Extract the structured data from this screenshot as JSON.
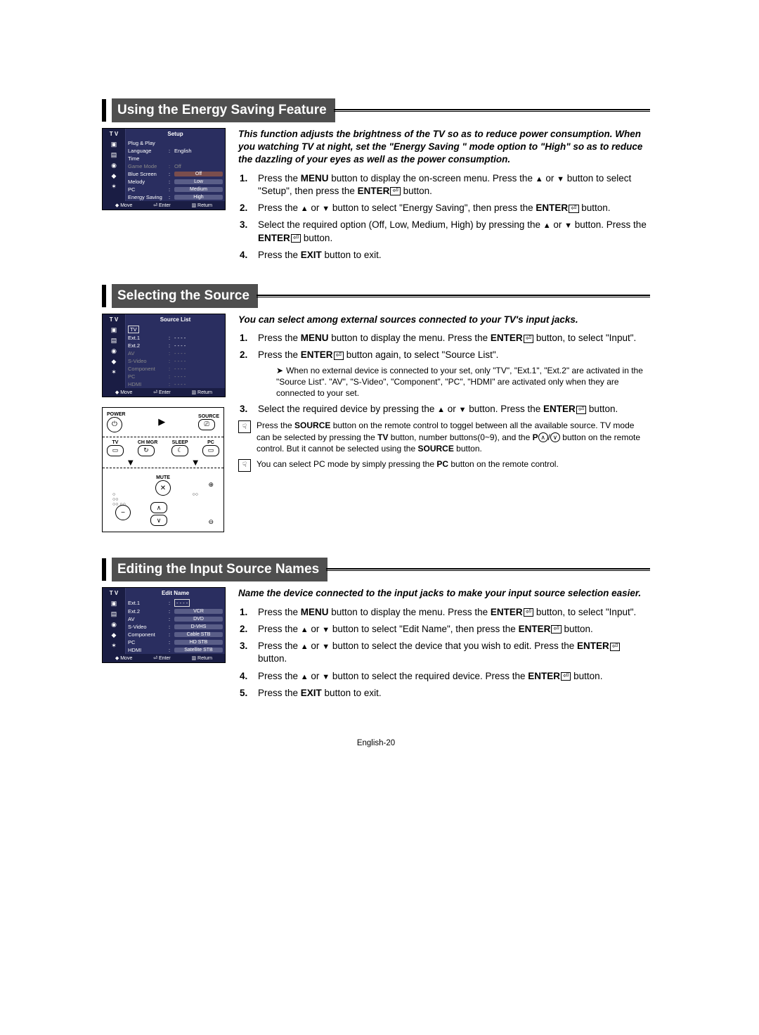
{
  "section1": {
    "title": "Using the Energy Saving Feature",
    "intro": "This function adjusts the brightness of the TV so as to reduce power consumption. When you watching TV at night, set the  \"Energy Saving \" mode option to \"High\" so as to reduce the dazzling of your eyes as well as the power consumption.",
    "steps": {
      "s1a": "Press the ",
      "s1b": " button to display the on-screen menu. Press the ",
      "s1c": " button to select \"Setup\", then press the ",
      "s1d": " button.",
      "s2a": "Press the ",
      "s2b": " button to select \"Energy Saving\", then press the ",
      "s2c": " button.",
      "s3a": "Select the required option (Off, Low, Medium, High) by pressing the ",
      "s3b": " button. Press the ",
      "s3c": " button.",
      "s4a": "Press the ",
      "s4b": " button to exit."
    },
    "osd": {
      "left": "T V",
      "title": "Setup",
      "rows": [
        {
          "label": "Plug & Play",
          "value": ""
        },
        {
          "label": "Language",
          "value": "English"
        },
        {
          "label": "Time",
          "value": ""
        },
        {
          "label": "Game Mode",
          "value": "Off",
          "dim": true
        },
        {
          "label": "Blue Screen",
          "value": "Off",
          "box": true,
          "hl": true
        },
        {
          "label": "Melody",
          "value": "Low",
          "box": true
        },
        {
          "label": "PC",
          "value": "Medium",
          "box": true
        },
        {
          "label": "Energy Saving",
          "value": "High",
          "box": true
        }
      ],
      "footer": {
        "move": "Move",
        "enter": "Enter",
        "ret": "Return"
      }
    }
  },
  "section2": {
    "title": "Selecting the Source",
    "intro": "You can select among external sources connected to your TV's input jacks.",
    "steps": {
      "s1a": "Press the ",
      "s1b": " button to display the menu. Press the ",
      "s1c": " button, to select \"Input\".",
      "s2a": "Press the ",
      "s2b": " button again, to select \"Source List\".",
      "note2": "When no external device is connected to your set, only \"TV\", \"Ext.1\", \"Ext.2\" are activated in the \"Source List\". \"AV\", \"S-Video\", \"Component\", \"PC\", \"HDMI\" are activated only when they are connected to your set.",
      "s3a": "Select the required device by pressing the ",
      "s3b": " button. Press the ",
      "s3c": " button."
    },
    "hint1a": "Press the ",
    "hint1b": " button on the remote control to toggel between all the available source. TV mode can be selected by pressing the ",
    "hint1c": " button, number buttons(0~9), and the ",
    "hint1d": " button on the remote control. But it cannot be selected using the ",
    "hint1e": " button.",
    "hint2a": "You can select PC mode by simply pressing the  ",
    "hint2b": " button on the remote control.",
    "osd": {
      "left": "T V",
      "title": "Source List",
      "rows": [
        {
          "label": "TV",
          "value": "",
          "sel": true
        },
        {
          "label": "Ext.1",
          "value": "- - - -"
        },
        {
          "label": "Ext.2",
          "value": "- - - -"
        },
        {
          "label": "AV",
          "value": "- - - -",
          "dim": true
        },
        {
          "label": "S-Video",
          "value": "- - - -",
          "dim": true
        },
        {
          "label": "Component",
          "value": "- - - -",
          "dim": true
        },
        {
          "label": "PC",
          "value": "- - - -",
          "dim": true
        },
        {
          "label": "HDMI",
          "value": "- - - -",
          "dim": true
        }
      ],
      "footer": {
        "move": "Move",
        "enter": "Enter",
        "ret": "Return"
      }
    },
    "remote": {
      "power": "POWER",
      "source": "SOURCE",
      "tv": "TV",
      "chmgr": "CH MGR",
      "sleep": "SLEEP",
      "pc": "PC",
      "mute": "MUTE"
    }
  },
  "section3": {
    "title": "Editing the Input Source Names",
    "intro": "Name the device connected to the input jacks to make your input source selection easier.",
    "steps": {
      "s1a": "Press the ",
      "s1b": " button to display the menu. Press the ",
      "s1c": " button, to select \"Input\".",
      "s2a": "Press the ",
      "s2b": " button to select \"Edit Name\", then press the ",
      "s2c": " button.",
      "s3a": "Press the ",
      "s3b": " button to select the device that you wish to edit. Press the ",
      "s3c": "  button.",
      "s4a": "Press the ",
      "s4b": " button to select the required device. Press the ",
      "s4c": " button.",
      "s5a": "Press the ",
      "s5b": " button to exit."
    },
    "osd": {
      "left": "T V",
      "title": "Edit Name",
      "rows": [
        {
          "label": "Ext.1",
          "value": "- - - -",
          "sel": true
        },
        {
          "label": "Ext.2",
          "value": "VCR",
          "box": true
        },
        {
          "label": "AV",
          "value": "DVD",
          "box": true
        },
        {
          "label": "S-Video",
          "value": "D-VHS",
          "box": true
        },
        {
          "label": "Component",
          "value": "Cable STB",
          "box": true
        },
        {
          "label": "PC",
          "value": "HD STB",
          "box": true
        },
        {
          "label": "HDMI",
          "value": "Satellite STB",
          "box": true
        }
      ],
      "footer": {
        "move": "Move",
        "enter": "Enter",
        "ret": "Return"
      }
    }
  },
  "labels": {
    "menu": "MENU",
    "enter": "ENTER",
    "exit": "EXIT",
    "source": "SOURCE",
    "tv": "TV",
    "pc": "PC",
    "p": "P",
    "or": " or ",
    "updown_sep": " or "
  },
  "footer": "English-20"
}
